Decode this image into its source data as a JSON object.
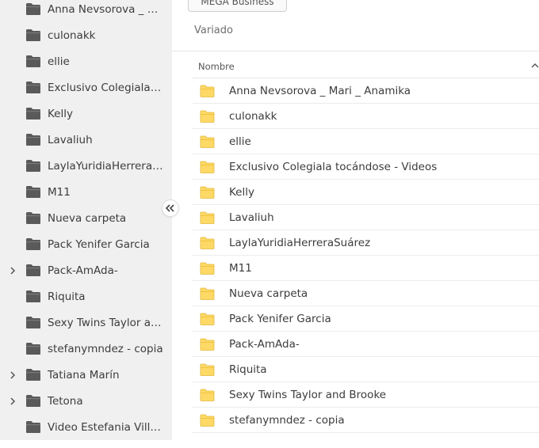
{
  "sidebar": {
    "items": [
      {
        "label": "Anna Nevsorova _ M...",
        "expandable": false
      },
      {
        "label": "culonakk",
        "expandable": false
      },
      {
        "label": "ellie",
        "expandable": false
      },
      {
        "label": "Exclusivo Colegiala t...",
        "expandable": false
      },
      {
        "label": "Kelly",
        "expandable": false
      },
      {
        "label": "Lavaliuh",
        "expandable": false
      },
      {
        "label": "LaylaYuridiaHerreraS...",
        "expandable": false
      },
      {
        "label": "M11",
        "expandable": false
      },
      {
        "label": "Nueva carpeta",
        "expandable": false
      },
      {
        "label": "Pack Yenifer Garcia",
        "expandable": false
      },
      {
        "label": "Pack-AmAda-",
        "expandable": true
      },
      {
        "label": "Riquita",
        "expandable": false
      },
      {
        "label": "Sexy Twins Taylor an...",
        "expandable": false
      },
      {
        "label": "stefanymndez - copia",
        "expandable": false
      },
      {
        "label": "Tatiana Marín",
        "expandable": true
      },
      {
        "label": "Tetona",
        "expandable": true
      },
      {
        "label": "Video Estefania Villa...",
        "expandable": false
      }
    ],
    "collapse_icon": "double-chevron-left-icon"
  },
  "toolbar": {
    "business_button_label": "MEGA Business"
  },
  "main": {
    "title": "Variado",
    "table": {
      "column_header": "Nombre",
      "sort_icon": "chevron-up-icon",
      "rows": [
        "Anna Nevsorova _ Mari _ Anamika",
        "culonakk",
        "ellie",
        "Exclusivo Colegiala tocándose - Videos",
        "Kelly",
        "Lavaliuh",
        "LaylaYuridiaHerreraSuárez",
        "M11",
        "Nueva carpeta",
        "Pack Yenifer Garcia",
        "Pack-AmAda-",
        "Riquita",
        "Sexy Twins Taylor and Brooke",
        "stefanymndez - copia"
      ]
    }
  },
  "colors": {
    "sidebar_bg": "#f0f0f0",
    "sidebar_folder": "#5a5a5a",
    "row_folder": "#ffd966",
    "row_folder_stroke": "#e0b73a"
  }
}
